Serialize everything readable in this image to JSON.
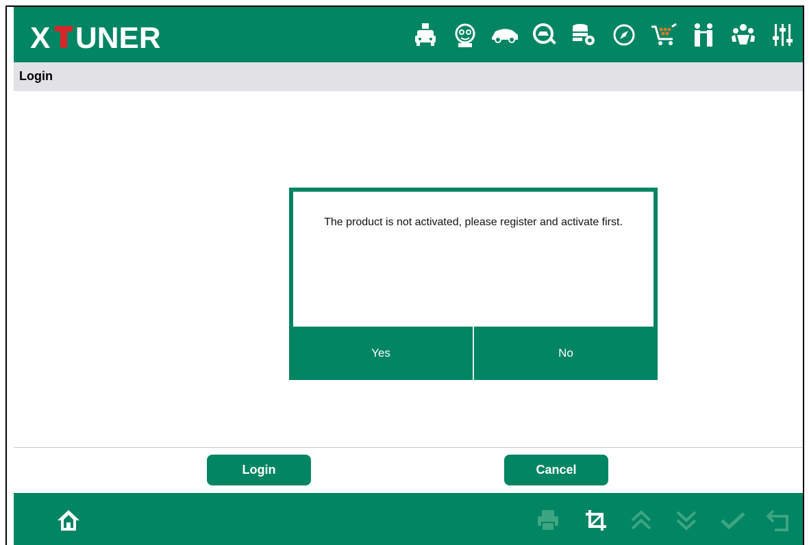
{
  "app": {
    "logo_text": "XTUNER",
    "brand_color": "#028563",
    "logo_accent_color": "#d7262a"
  },
  "toolbar": {
    "icons": [
      "car-doctor-icon",
      "mechanic-icon",
      "car-icon",
      "car-search-icon",
      "database-settings-icon",
      "compass-icon",
      "shopping-cart-icon",
      "people-icon",
      "group-icon",
      "sliders-icon"
    ]
  },
  "titlebar": {
    "title": "Login"
  },
  "dialog": {
    "message": "The product is not activated, please register and activate first.",
    "yes_label": "Yes",
    "no_label": "No"
  },
  "actions": {
    "login_label": "Login",
    "cancel_label": "Cancel"
  },
  "bottombar": {
    "icons": [
      "home-icon",
      "print-icon",
      "crop-icon",
      "page-up-icon",
      "page-down-icon",
      "check-icon",
      "back-icon"
    ],
    "disabled_color": "#3da581"
  }
}
